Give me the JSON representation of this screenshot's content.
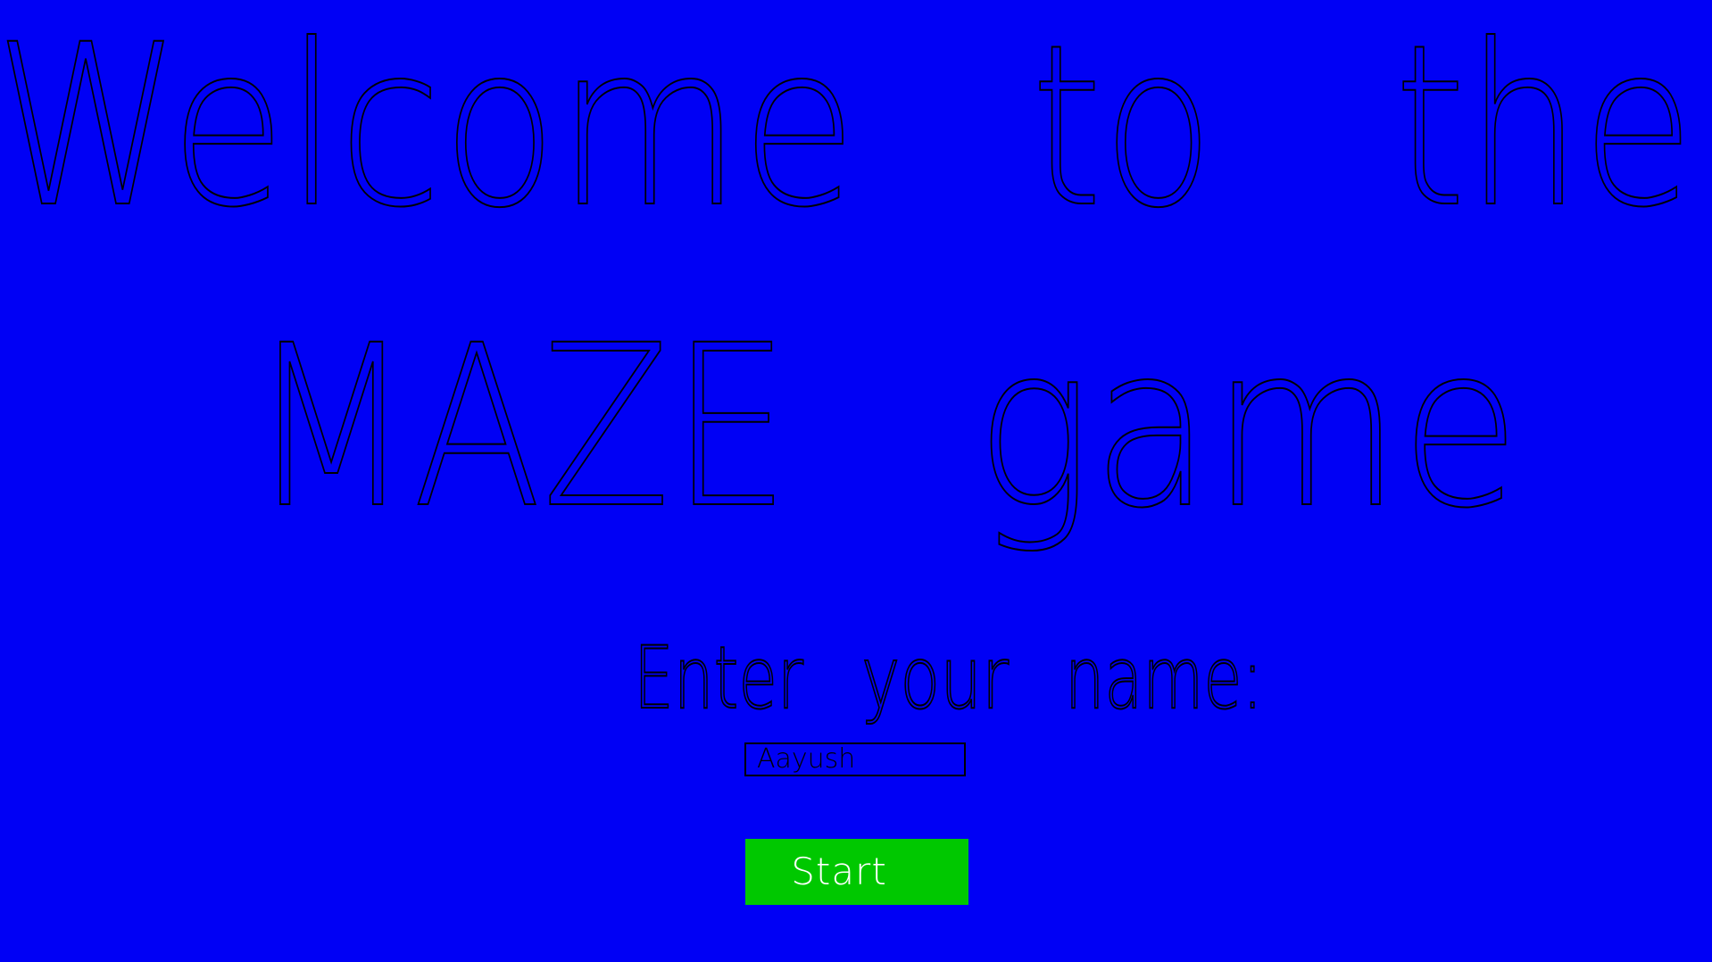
{
  "title": {
    "line1_words": [
      "Welcome",
      "to",
      "the"
    ],
    "line2_words": [
      "MAZE",
      "game"
    ]
  },
  "prompt": {
    "words": [
      "Enter",
      "your",
      "name:"
    ]
  },
  "name_input": {
    "value": "Aayush"
  },
  "start_button": {
    "label": "Start"
  },
  "colors": {
    "background": "#0000f5",
    "outline_text": "#000000",
    "start_button": "#00c800",
    "start_label": "#ffffff"
  }
}
